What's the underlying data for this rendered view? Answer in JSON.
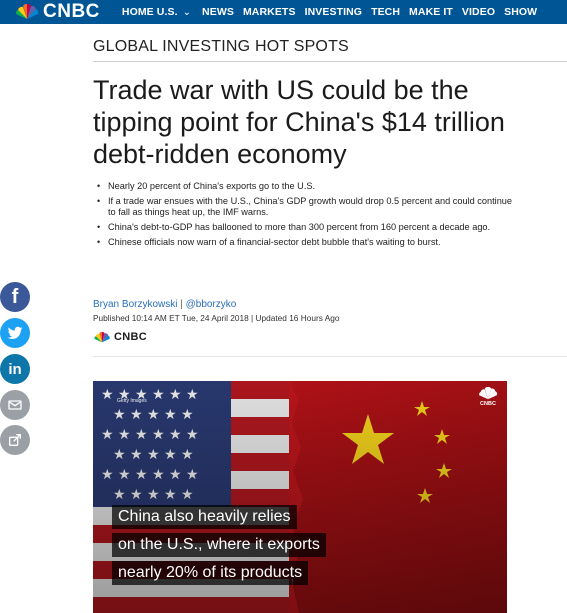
{
  "header": {
    "logo_text": "CNBC",
    "nav": [
      {
        "label": "HOME U.S."
      },
      {
        "label": "NEWS"
      },
      {
        "label": "MARKETS"
      },
      {
        "label": "INVESTING"
      },
      {
        "label": "TECH"
      },
      {
        "label": "MAKE IT"
      },
      {
        "label": "VIDEO"
      },
      {
        "label": "SHOW"
      }
    ],
    "bar_color": "#005594"
  },
  "article": {
    "section": "GLOBAL INVESTING HOT SPOTS",
    "headline": "Trade war with US could be the tipping point for China's $14 trillion debt-ridden economy",
    "bullets": [
      "Nearly 20 percent of China's exports go to the U.S.",
      "If a trade war ensues with the U.S., China's GDP growth would drop 0.5 percent and could continue to fall as things heat up, the IMF warns.",
      "China's debt-to-GDP has ballooned to more than 300 percent from 160 percent a decade ago.",
      "Chinese officials now warn of a financial-sector debt bubble that's waiting to burst."
    ],
    "author": "Bryan Borzykowski",
    "author_sep": "|",
    "handle": "@bborzyko",
    "published": "Published 10:14 AM ET Tue, 24 April 2018 | Updated 16 Hours Ago",
    "source_logo_text": "CNBC"
  },
  "social": [
    {
      "name": "facebook-icon",
      "glyph": "f"
    },
    {
      "name": "twitter-icon",
      "glyph": ""
    },
    {
      "name": "linkedin-icon",
      "glyph": "in"
    },
    {
      "name": "email-icon",
      "glyph": ""
    },
    {
      "name": "share-icon",
      "glyph": ""
    }
  ],
  "hero": {
    "credit": "Getty Images",
    "logo_text": "CNBC",
    "caption": [
      "China also heavily relies",
      "on the U.S., where it exports",
      "nearly 20% of its products"
    ]
  }
}
